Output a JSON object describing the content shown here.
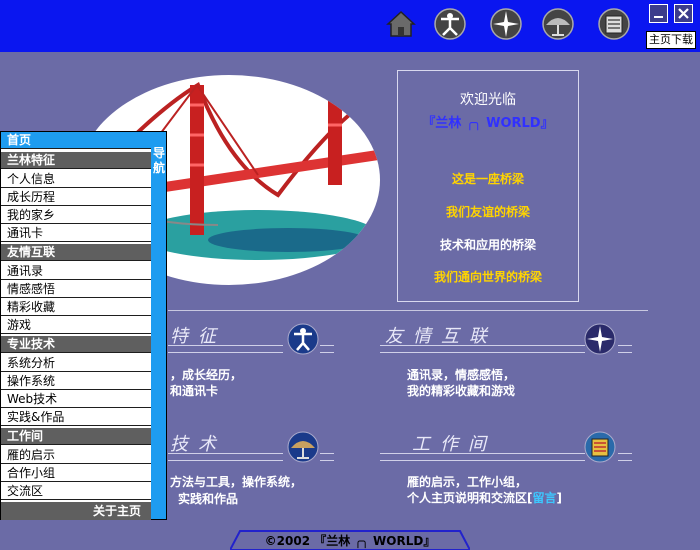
{
  "toolbar": {
    "icons": [
      "home-icon",
      "vitruvian-icon",
      "star-icon",
      "dish-icon",
      "book-icon"
    ],
    "download_label": "主页下载"
  },
  "welcome": {
    "title": "欢迎光临",
    "world": "『兰林 ╭╮ WORLD』",
    "lines": [
      "这是一座桥梁",
      "我们友谊的桥梁",
      "技术和应用的桥梁",
      "我们通向世界的桥梁"
    ]
  },
  "sections": {
    "s1_title": "特征",
    "s1_desc1": "，成长经历，",
    "s1_desc2": "和通讯卡",
    "s2_title": "友情互联",
    "s2_desc1": "通讯录，情感感悟，",
    "s2_desc2": "我的精彩收藏和游戏",
    "s3_title": "技术",
    "s3_desc1": "方法与工具，操作系统，",
    "s3_desc2": "实践和作品",
    "s4_title": "工作间",
    "s4_desc1": "雁的启示，工作小组，",
    "s4_desc2": "个人主页说明和交流区[",
    "s4_link": "留言",
    "s4_end": "]"
  },
  "menu": {
    "home": "首页",
    "nav": "导航",
    "groups": [
      {
        "title": "兰林特征",
        "items": [
          "个人信息",
          "成长历程",
          "我的家乡",
          "通讯卡"
        ]
      },
      {
        "title": "友情互联",
        "items": [
          "通讯录",
          "情感感悟",
          "精彩收藏",
          "游戏"
        ]
      },
      {
        "title": "专业技术",
        "items": [
          "系统分析",
          "操作系统",
          "Web技术",
          "实践&作品"
        ]
      },
      {
        "title": "工作间",
        "items": [
          "雁的启示",
          "合作小组",
          "交流区"
        ]
      }
    ],
    "about": "关于主页"
  },
  "footer": {
    "text": "©2002 『兰林 ╭╮ WORLD』"
  }
}
